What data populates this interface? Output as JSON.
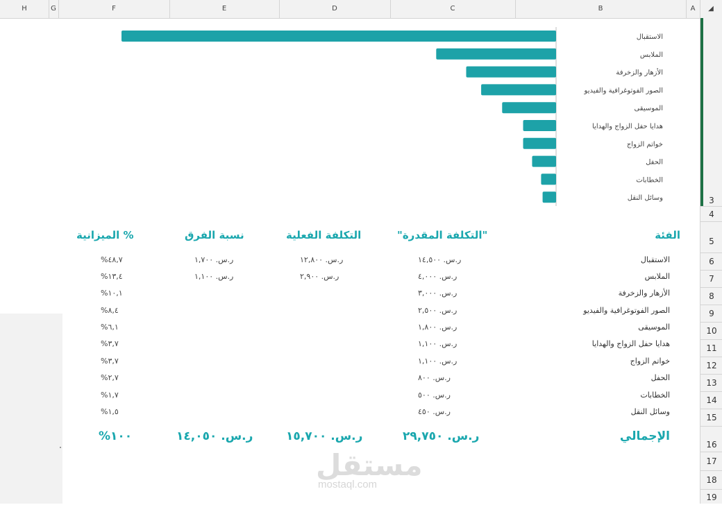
{
  "columns": [
    "H",
    "G",
    "F",
    "E",
    "D",
    "C",
    "B",
    "A"
  ],
  "rows": [
    "3",
    "4",
    "5",
    "6",
    "7",
    "8",
    "9",
    "10",
    "11",
    "12",
    "13",
    "14",
    "15",
    "16",
    "17",
    "18",
    "19"
  ],
  "chart_data": {
    "type": "bar",
    "orientation": "horizontal",
    "categories": [
      "الاستقبال",
      "الملابس",
      "الأزهار والزخرفة",
      "الصور الفوتوغرافية والفيديو",
      "الموسيقى",
      "هدايا حفل الزواج والهدايا",
      "خواتم الزواج",
      "الحفل",
      "الخطابات",
      "وسائل النقل"
    ],
    "values": [
      14500,
      4000,
      3000,
      2500,
      1800,
      1100,
      1100,
      800,
      500,
      450
    ],
    "color": "#1da2a8"
  },
  "table": {
    "headers": {
      "category": "الفئة",
      "estimated": "\"التكلفة المقدرة\"",
      "actual": "التكلفة الفعلية",
      "diff": "نسبة الفرق",
      "budget": "الميزانية %"
    },
    "rows": [
      {
        "cat": "الاستقبال",
        "est": "ر.س. ١٤,٥٠٠",
        "act": "ر.س. ١٢,٨٠٠",
        "diff": "ر.س. ١,٧٠٠",
        "pct": "%٤٨,٧"
      },
      {
        "cat": "الملابس",
        "est": "ر.س. ٤,٠٠٠",
        "act": "ر.س. ٢,٩٠٠",
        "diff": "ر.س. ١,١٠٠",
        "pct": "%١٣,٤"
      },
      {
        "cat": "الأزهار والزخرفة",
        "est": "ر.س. ٣,٠٠٠",
        "act": "",
        "diff": "",
        "pct": "%١٠,١"
      },
      {
        "cat": "الصور الفوتوغرافية والفيديو",
        "est": "ر.س. ٢,٥٠٠",
        "act": "",
        "diff": "",
        "pct": "%٨,٤"
      },
      {
        "cat": "الموسيقى",
        "est": "ر.س. ١,٨٠٠",
        "act": "",
        "diff": "",
        "pct": "%٦,١"
      },
      {
        "cat": "هدايا حفل الزواج والهدايا",
        "est": "ر.س. ١,١٠٠",
        "act": "",
        "diff": "",
        "pct": "%٣,٧"
      },
      {
        "cat": "خواتم الزواج",
        "est": "ر.س. ١,١٠٠",
        "act": "",
        "diff": "",
        "pct": "%٣,٧"
      },
      {
        "cat": "الحفل",
        "est": "ر.س. ٨٠٠",
        "act": "",
        "diff": "",
        "pct": "%٢,٧"
      },
      {
        "cat": "الخطابات",
        "est": "ر.س. ٥٠٠",
        "act": "",
        "diff": "",
        "pct": "%١,٧"
      },
      {
        "cat": "وسائل النقل",
        "est": "ر.س. ٤٥٠",
        "act": "",
        "diff": "",
        "pct": "%١,٥"
      }
    ],
    "totals": {
      "label": "الإجمالي",
      "est": "ر.س. ٢٩,٧٥٠",
      "act": "ر.س. ١٥,٧٠٠",
      "diff": "ر.س. ١٤,٠٥٠",
      "pct": "%١٠٠"
    }
  },
  "watermark": {
    "text": "مستقل",
    "sub": "mostaql.com"
  }
}
